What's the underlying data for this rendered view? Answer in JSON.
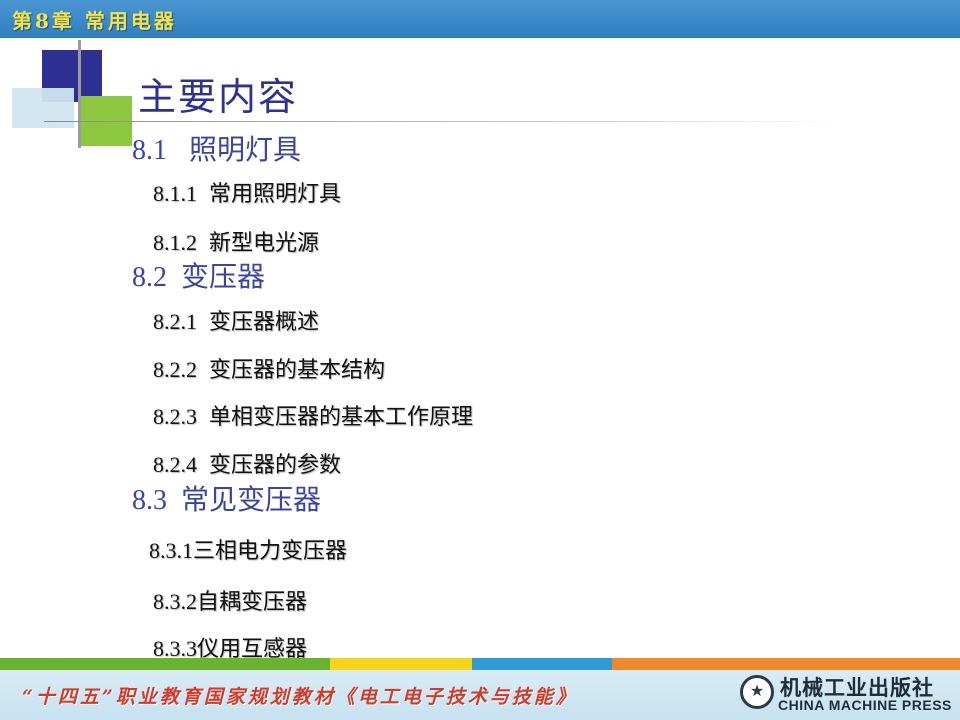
{
  "header": {
    "chapter_title": "第8章  常用电器"
  },
  "main": {
    "title": "主要内容",
    "outline": [
      {
        "num": "8.1",
        "text": "照明灯具"
      },
      {
        "num": "8.1.1",
        "text": "常用照明灯具"
      },
      {
        "num": "8.1.2",
        "text": "新型电光源"
      },
      {
        "num": "8.2",
        "text": "变压器"
      },
      {
        "num": "8.2.1",
        "text": "变压器概述"
      },
      {
        "num": "8.2.2",
        "text": "变压器的基本结构"
      },
      {
        "num": "8.2.3",
        "text": "单相变压器的基本工作原理"
      },
      {
        "num": "8.2.4",
        "text": "变压器的参数"
      },
      {
        "num": "8.3",
        "text": "常见变压器"
      },
      {
        "num": "8.3.1",
        "text": "三相电力变压器"
      },
      {
        "num": "8.3.2",
        "text": "自耦变压器"
      },
      {
        "num": "8.3.3",
        "text": "仪用互感器"
      }
    ]
  },
  "footer": {
    "series_text": "“十四五”职业教育国家规划教材《电工电子技术与技能》",
    "publisher_cn": "机械工业出版社",
    "publisher_en": "CHINA MACHINE PRESS"
  },
  "colors": {
    "header_bar": "#3a8bcb",
    "title": "#2d3192",
    "section": "#3a44a6",
    "footer_text": "#d23a2a",
    "stripe_green": "#6ab42d",
    "stripe_yellow": "#f7d417",
    "stripe_blue": "#2e9ad6",
    "stripe_orange": "#f0892c"
  },
  "icons": {
    "publisher_logo": "publisher-logo-icon"
  }
}
